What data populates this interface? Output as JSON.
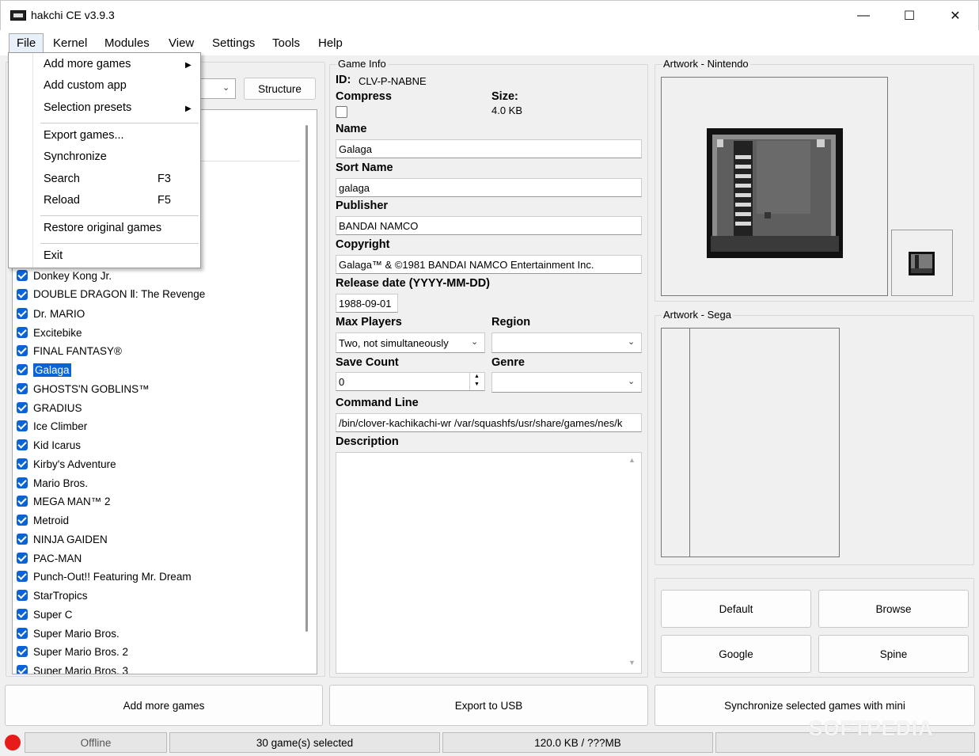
{
  "window": {
    "title": "hakchi CE v3.9.3",
    "minimize_glyph": "—",
    "maximize_glyph": "☐",
    "close_glyph": "✕"
  },
  "menubar": {
    "items": [
      "File",
      "Kernel",
      "Modules",
      "View",
      "Settings",
      "Tools",
      "Help"
    ]
  },
  "file_menu": {
    "add_more_games": "Add more games",
    "add_custom_app": "Add custom app",
    "selection_presets": "Selection presets",
    "export_games": "Export games...",
    "synchronize": "Synchronize",
    "search": "Search",
    "search_key": "F3",
    "reload": "Reload",
    "reload_key": "F5",
    "restore_original": "Restore original games",
    "exit": "Exit",
    "submenu_arrow": "▶"
  },
  "left": {
    "structure_button": "Structure",
    "games": [
      "Donkey Kong Jr.",
      "DOUBLE DRAGON Ⅱ: The Revenge",
      "Dr. MARIO",
      "Excitebike",
      "FINAL FANTASY®",
      "Galaga",
      "GHOSTS'N GOBLINS™",
      "GRADIUS",
      "Ice Climber",
      "Kid Icarus",
      "Kirby's Adventure",
      "Mario Bros.",
      "MEGA MAN™ 2",
      "Metroid",
      "NINJA GAIDEN",
      "PAC-MAN",
      "Punch-Out!! Featuring Mr. Dream",
      "StarTropics",
      "Super C",
      "Super Mario Bros.",
      "Super Mario Bros. 2",
      "Super Mario Bros. 3"
    ],
    "selected_game": "Galaga"
  },
  "game_info": {
    "group_label": "Game Info",
    "id_label": "ID:",
    "id_value": "CLV-P-NABNE",
    "compress_label": "Compress",
    "size_label": "Size:",
    "size_value": "4.0 KB",
    "name_label": "Name",
    "name_value": "Galaga",
    "sort_name_label": "Sort Name",
    "sort_name_value": "galaga",
    "publisher_label": "Publisher",
    "publisher_value": "BANDAI NAMCO",
    "copyright_label": "Copyright",
    "copyright_value": "Galaga™ & ©1981 BANDAI NAMCO Entertainment Inc.",
    "release_label": "Release date (YYYY-MM-DD)",
    "release_value": "1988-09-01",
    "max_players_label": "Max Players",
    "max_players_value": "Two, not simultaneously",
    "region_label": "Region",
    "region_value": "",
    "save_count_label": "Save Count",
    "save_count_value": "0",
    "genre_label": "Genre",
    "genre_value": "",
    "command_line_label": "Command Line",
    "command_line_value": "/bin/clover-kachikachi-wr /var/squashfs/usr/share/games/nes/k",
    "description_label": "Description",
    "description_value": ""
  },
  "artwork": {
    "nintendo_label": "Artwork - Nintendo",
    "sega_label": "Artwork - Sega",
    "default_button": "Default",
    "browse_button": "Browse",
    "google_button": "Google",
    "spine_button": "Spine"
  },
  "bottom": {
    "add_more_games": "Add more games",
    "export_usb": "Export to USB",
    "synchronize": "Synchronize selected games with mini"
  },
  "status": {
    "connection": "Offline",
    "selected": "30 game(s) selected",
    "size": "120.0 KB / ???MB",
    "indicator_color": "#e81b1b"
  },
  "watermark": "SOFTPEDIA"
}
